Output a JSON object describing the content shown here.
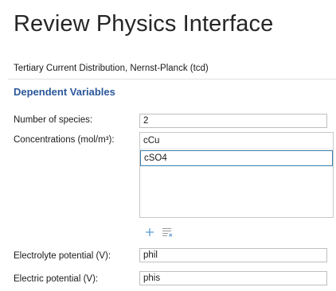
{
  "header": {
    "title": "Review Physics Interface",
    "interface_name": "Tertiary Current Distribution, Nernst-Planck (tcd)"
  },
  "section": {
    "title": "Dependent Variables"
  },
  "fields": {
    "species": {
      "label": "Number of species:",
      "value": "2"
    },
    "concentrations": {
      "label": "Concentrations (mol/m³):",
      "items": [
        "cCu",
        "cSO4"
      ],
      "selected_index": 1
    },
    "electrolyte_potential": {
      "label": "Electrolyte potential (V):",
      "value": "phil"
    },
    "electric_potential": {
      "label": "Electric potential (V):",
      "value": "phis"
    }
  },
  "toolbar": {
    "add_icon": "plus-icon",
    "clear_icon": "clear-table-icon"
  },
  "colors": {
    "section_title": "#2b579a",
    "selection_border": "#3c7fb1",
    "icon_blue": "#5b9bd5"
  }
}
